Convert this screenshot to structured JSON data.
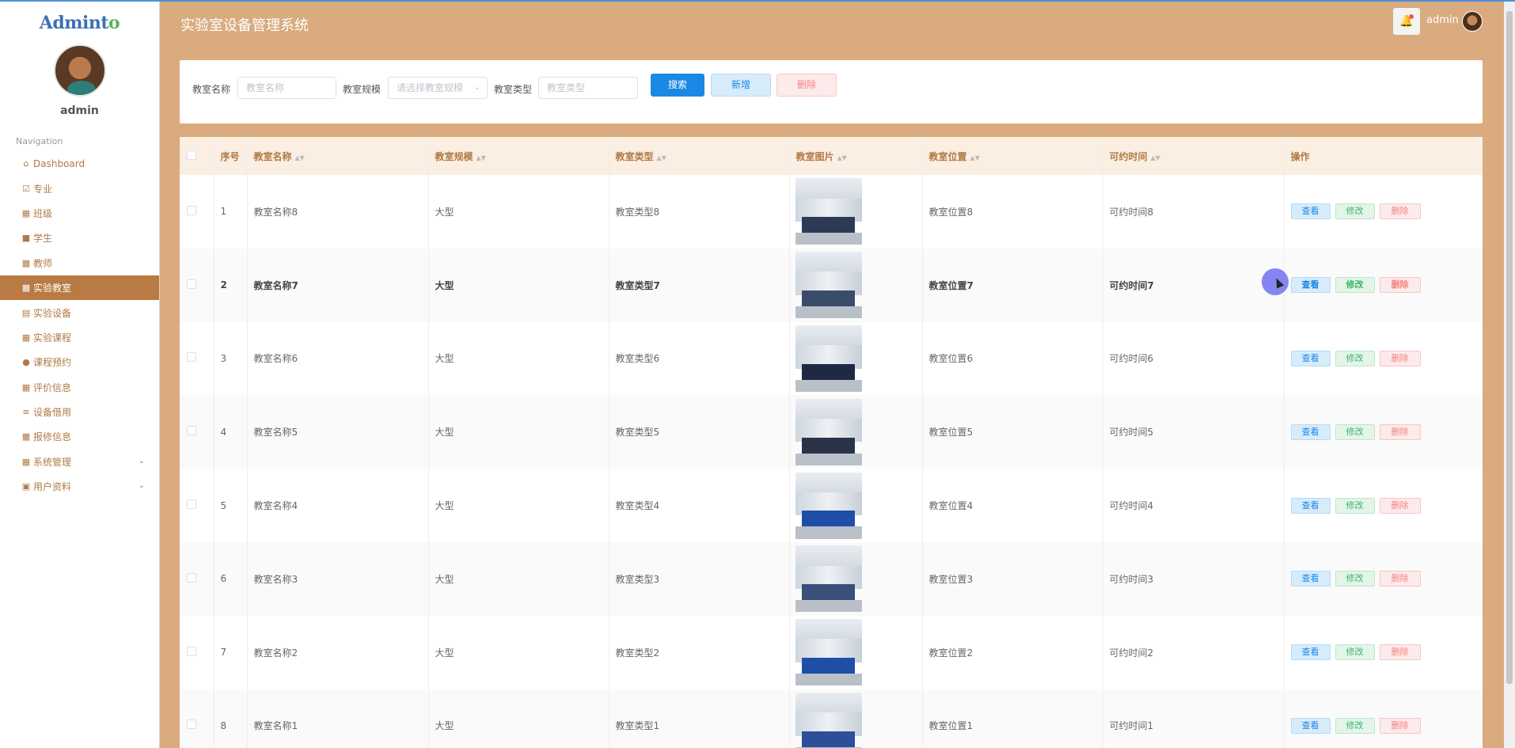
{
  "app": {
    "logo": "Adminto",
    "title": "实验室设备管理系统",
    "user": "admin"
  },
  "sidebar": {
    "user_name": "admin",
    "nav_title": "Navigation",
    "items": [
      {
        "label": "Dashboard",
        "icon": "home-icon"
      },
      {
        "label": "专业",
        "icon": "checkbox-icon"
      },
      {
        "label": "班级",
        "icon": "grid-icon"
      },
      {
        "label": "学生",
        "icon": "briefcase-icon"
      },
      {
        "label": "教师",
        "icon": "books-icon"
      },
      {
        "label": "实验教室",
        "icon": "apps-icon",
        "active": true
      },
      {
        "label": "实验设备",
        "icon": "clipboard-icon"
      },
      {
        "label": "实验课程",
        "icon": "apps-icon"
      },
      {
        "label": "课程预约",
        "icon": "user-icon"
      },
      {
        "label": "评价信息",
        "icon": "apps-icon"
      },
      {
        "label": "设备借用",
        "icon": "sliders-icon"
      },
      {
        "label": "报修信息",
        "icon": "printer-icon"
      },
      {
        "label": "系统管理",
        "icon": "apps-icon",
        "expandable": true
      },
      {
        "label": "用户资料",
        "icon": "card-icon",
        "expandable": true
      }
    ]
  },
  "search": {
    "name_label": "教室名称",
    "name_placeholder": "教室名称",
    "scale_label": "教室规模",
    "scale_placeholder": "请选择教室规模",
    "type_label": "教室类型",
    "type_placeholder": "教室类型",
    "search_button": "搜索",
    "add_button": "新增",
    "delete_button": "删除"
  },
  "table": {
    "columns": [
      "序号",
      "教室名称",
      "教室规模",
      "教室类型",
      "教室图片",
      "教室位置",
      "可约时间",
      "操作"
    ],
    "action_labels": {
      "view": "查看",
      "edit": "修改",
      "delete": "删除"
    },
    "rows": [
      {
        "index": "1",
        "name": "教室名称8",
        "scale": "大型",
        "type": "教室类型8",
        "location": "教室位置8",
        "time": "可约时间8"
      },
      {
        "index": "2",
        "name": "教室名称7",
        "scale": "大型",
        "type": "教室类型7",
        "location": "教室位置7",
        "time": "可约时间7"
      },
      {
        "index": "3",
        "name": "教室名称6",
        "scale": "大型",
        "type": "教室类型6",
        "location": "教室位置6",
        "time": "可约时间6"
      },
      {
        "index": "4",
        "name": "教室名称5",
        "scale": "大型",
        "type": "教室类型5",
        "location": "教室位置5",
        "time": "可约时间5"
      },
      {
        "index": "5",
        "name": "教室名称4",
        "scale": "大型",
        "type": "教室类型4",
        "location": "教室位置4",
        "time": "可约时间4"
      },
      {
        "index": "6",
        "name": "教室名称3",
        "scale": "大型",
        "type": "教室类型3",
        "location": "教室位置3",
        "time": "可约时间3"
      },
      {
        "index": "7",
        "name": "教室名称2",
        "scale": "大型",
        "type": "教室类型2",
        "location": "教室位置2",
        "time": "可约时间2"
      },
      {
        "index": "8",
        "name": "教室名称1",
        "scale": "大型",
        "type": "教室类型1",
        "location": "教室位置1",
        "time": "可约时间1"
      }
    ]
  },
  "colors": {
    "header_bg": "#d9ab7e",
    "sidebar_active": "#b97a43",
    "accent_blue": "#1c88e5"
  }
}
